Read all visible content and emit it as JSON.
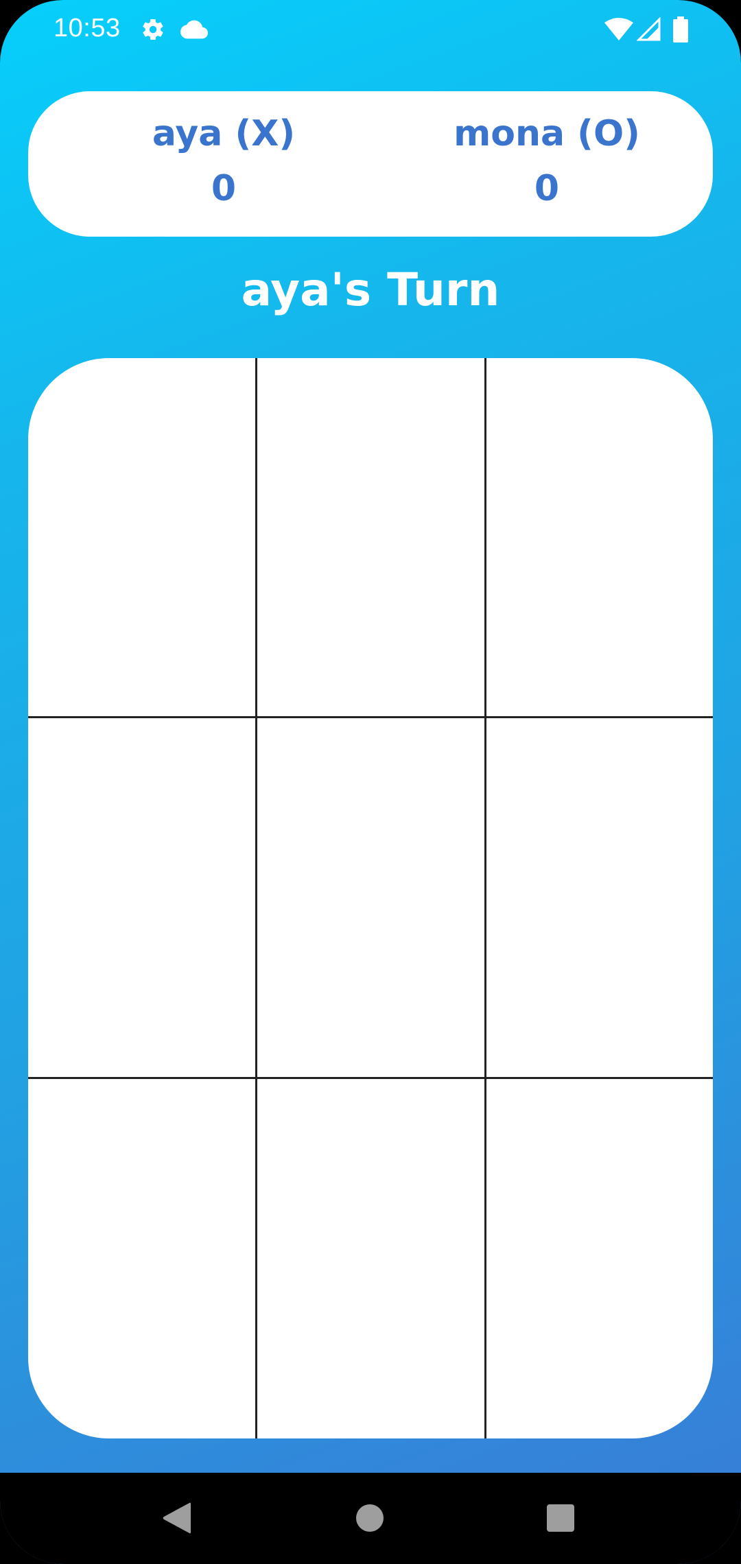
{
  "status_bar": {
    "time": "10:53",
    "icons": [
      "gear-icon",
      "cloud-icon",
      "wifi-icon",
      "signal-icon",
      "battery-icon"
    ]
  },
  "scoreboard": {
    "player_x": {
      "name": "aya (X)",
      "score": "0"
    },
    "player_o": {
      "name": "mona (O)",
      "score": "0"
    }
  },
  "turn_label": "aya's Turn",
  "board": {
    "cells": [
      "",
      "",
      "",
      "",
      "",
      "",
      "",
      "",
      ""
    ]
  },
  "nav_bar": {
    "buttons": [
      "back-icon",
      "home-icon",
      "recents-icon"
    ]
  },
  "colors": {
    "accent_text": "#3a74cc",
    "gradient_top": "#06cffc",
    "gradient_bottom": "#3a7bd6"
  }
}
